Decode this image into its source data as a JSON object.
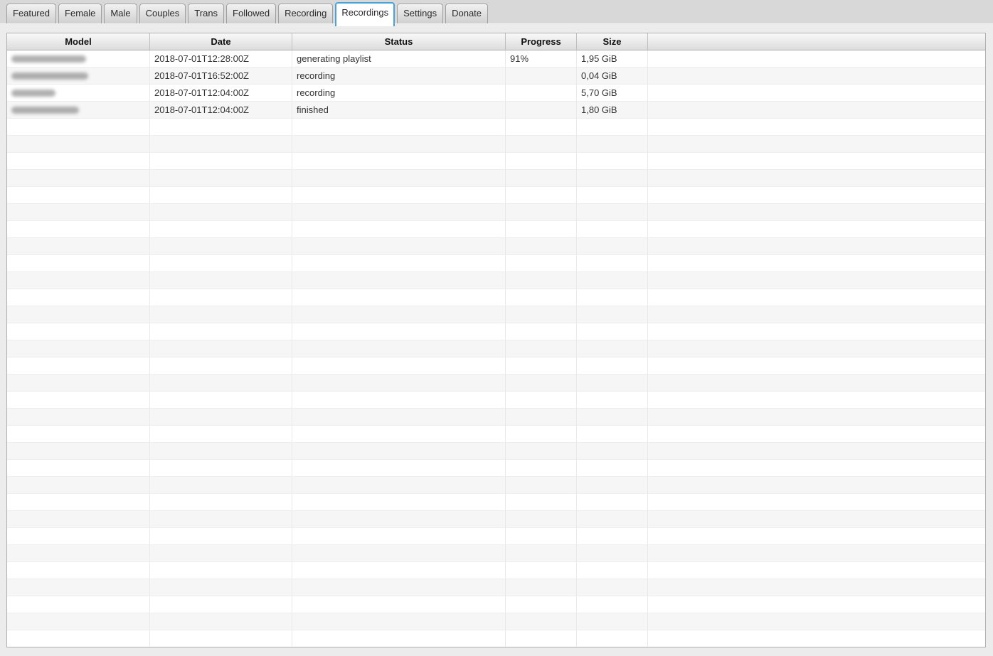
{
  "tabs": {
    "items": [
      {
        "label": "Featured",
        "active": false
      },
      {
        "label": "Female",
        "active": false
      },
      {
        "label": "Male",
        "active": false
      },
      {
        "label": "Couples",
        "active": false
      },
      {
        "label": "Trans",
        "active": false
      },
      {
        "label": "Followed",
        "active": false
      },
      {
        "label": "Recording",
        "active": false
      },
      {
        "label": "Recordings",
        "active": true
      },
      {
        "label": "Settings",
        "active": false
      },
      {
        "label": "Donate",
        "active": false
      }
    ]
  },
  "table": {
    "columns": [
      {
        "label": "Model"
      },
      {
        "label": "Date"
      },
      {
        "label": "Status"
      },
      {
        "label": "Progress"
      },
      {
        "label": "Size"
      },
      {
        "label": ""
      }
    ],
    "rows": [
      {
        "model_redacted": true,
        "model_blur_width": 105,
        "date": "2018-07-01T12:28:00Z",
        "status": "generating playlist",
        "progress": "91%",
        "size": "1,95 GiB"
      },
      {
        "model_redacted": true,
        "model_blur_width": 108,
        "date": "2018-07-01T16:52:00Z",
        "status": "recording",
        "progress": "",
        "size": "0,04 GiB"
      },
      {
        "model_redacted": true,
        "model_blur_width": 62,
        "date": "2018-07-01T12:04:00Z",
        "status": "recording",
        "progress": "",
        "size": "5,70 GiB"
      },
      {
        "model_redacted": true,
        "model_blur_width": 95,
        "date": "2018-07-01T12:04:00Z",
        "status": "finished",
        "progress": "",
        "size": "1,80 GiB"
      }
    ],
    "empty_row_count": 31
  },
  "colors": {
    "active_tab_border": "#47a3d9",
    "row_stripe": "#f6f6f6",
    "header_gradient_top": "#f9f9f9",
    "header_gradient_bottom": "#dcdcdc"
  }
}
